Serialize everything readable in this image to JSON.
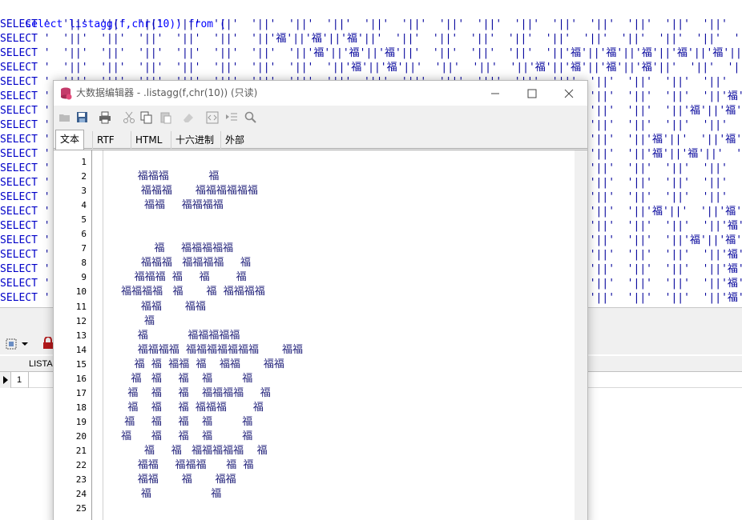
{
  "sql": {
    "first_line": "select listagg(f,chr(10)) from (",
    "select_keyword": "SELECT",
    "rows": [
      " '  '||'  '||'  '||'  '||'  '||'  '||'  '||'  '||'  '||'  '||'  '||'  '||'  '||'  '||'  '||'  '||'  '||'  '||'  '||'  '||",
      " '  '||'  '||'  '||'  '||'  '||'  '||'福'||'福'||'福'||'  '||'  '||'  '||'  '||'  '||'  '||'  '||'  '||'  '||'  '||'  '||",
      " '  '||'  '||'  '||'  '||'  '||'  '||'  '||'福'||'福'||'福'||'  '||'  '||'  '||'  '||'福'||'福'||'福'||'福'||'福'||'福'||",
      " '  '||'  '||'  '||'  '||'  '||'  '||'  '||'  '||'福'||'福'||'  '||'  '||'  '||'福'||'福'||'福'||'福'||'  '||'  '||'  '||",
      " '  '||'  '||'  '||'  '||'  '||'  '||'  '||'  '||'  '||'  '||'  '||'  '||'  '||'  '||'  '||'  '||'  '||'  '||'  '||'  '||",
      " '  '||'  '||'  '||'  '||'  '||'  '||'  '||'  '||'  '||'  '||'  '||'  '||'  '||'  '||'  '||'  '||'  '||'  '||'福'||'  '||",
      " '  '||'  '||'  '||'  '||'  '||'  '||'  '||'  '||'  '||'  '||'  '||'  '||'  '||'  '||'  '||'  '||'  '||'福'||'福'||'  '||",
      " '  '||'  '||'  '||'  '||'  '||'  '||'  '||'  '||'  '||'  '||'  '||'  '||'  '||'  '||'  '||'  '||'  '||'  '||'  '||'  '||",
      " '  '||'  '||'  '||'  '||'  '||'  '||'  '||'  '||'  '||'  '||'  '||'  '||'  '||'  '||'  '||'  '||'福'||'  '||'福'||'福'||",
      " '  '||'  '||'  '||'  '||'  '||'  '||'  '||'  '||'  '||'  '||'  '||'  '||'  '||'  '||'  '||'  '||'福'||'福'||'  '||'  '||",
      " '  '||'  '||'  '||'  '||'  '||'  '||'  '||'  '||'  '||'  '||'  '||'  '||'  '||'  '||'  '||'  '||'  '||'  '||'  '||'  '||",
      " '  '||'  '||'  '||'  '||'  '||'  '||'  '||'  '||'  '||'  '||'  '||'  '||'  '||'  '||'  '||'  '||'  '||'  '||'  '||'  '||",
      " '  '||'  '||'  '||'  '||'  '||'  '||'  '||'  '||'  '||'  '||'  '||'  '||'  '||'  '||'  '||'  '||'  '||'  '||'  '||'  '||",
      " '  '||'  '||'  '||'  '||'  '||'  '||'  '||'  '||'  '||'  '||'  '||'  '||'  '||'  '||'  '||'  '||'福'||'  '||'福'||'  '||",
      " '  '||'  '||'  '||'  '||'  '||'  '||'  '||'  '||'  '||'  '||'  '||'  '||'  '||'  '||'  '||'  '||'  '||'  '||'福'||'  '||",
      " '  '||'  '||'  '||'  '||'  '||'  '||'  '||'  '||'  '||'  '||'  '||'  '||'  '||'  '||'  '||'  '||'  '||'福'||'福'||'  '||",
      " '  '||'  '||'  '||'  '||'  '||'  '||'  '||'  '||'  '||'  '||'  '||'  '||'  '||'  '||'  '||'  '||'  '||'  '||'福'||'  '||",
      " '  '||'  '||'  '||'  '||'  '||'  '||'  '||'  '||'  '||'  '||'  '||'  '||'  '||'  '||'  '||'  '||'  '||'  '||'福'||'  '||",
      " '  '||'  '||'  '||'  '||'  '||'  '||'  '||'  '||'  '||'  '||'  '||'  '||'  '||'  '||'  '||'  '||'  '||'  '||'福'||'  '||",
      " '  '||'  '||'  '||'  '||'  '||'  '||'  '||'  '||'  '||'  '||'  '||'  '||'  '||'  '||'  '||'  '||'  '||'  '||'福'||'  '||"
    ]
  },
  "editor": {
    "title": "大数据编辑器 - .listagg(f,chr(10)) (只读)",
    "tabs": [
      "文本",
      "RTF",
      "HTML",
      "十六进制",
      "外部"
    ],
    "line_numbers": [
      "1",
      "2",
      "3",
      "4",
      "5",
      "6",
      "7",
      "8",
      "9",
      "10",
      "11",
      "12",
      "13",
      "14",
      "15",
      "16",
      "17",
      "18",
      "19",
      "20",
      "21",
      "22",
      "23",
      "24",
      "25"
    ],
    "lines": [
      "",
      "      福福福            福",
      "       福福福       福福福福福福",
      "        福福     福福福福",
      "",
      "",
      "           福     福福福福福",
      "       福福福   福福福福     福",
      "     福福福  福     福        福",
      " 福福福福   福       福  福福福福",
      "       福福       福福",
      "        福",
      "      福            福福福福福",
      "      福福福福  福福福福福福福       福福",
      "     福  福  福福  福    福福       福福",
      "    福   福     福    福         福",
      "   福    福     福    福福福福     福",
      "   福    福     福  福福福        福",
      "  福     福     福    福         福",
      " 福      福     福    福         福",
      "        福     福   福福福福福    福",
      "      福福     福福福      福  福",
      "      福福       福       福福",
      "       福                  福",
      ""
    ]
  },
  "grid": {
    "column_header": "LISTA",
    "row_number": "1"
  }
}
